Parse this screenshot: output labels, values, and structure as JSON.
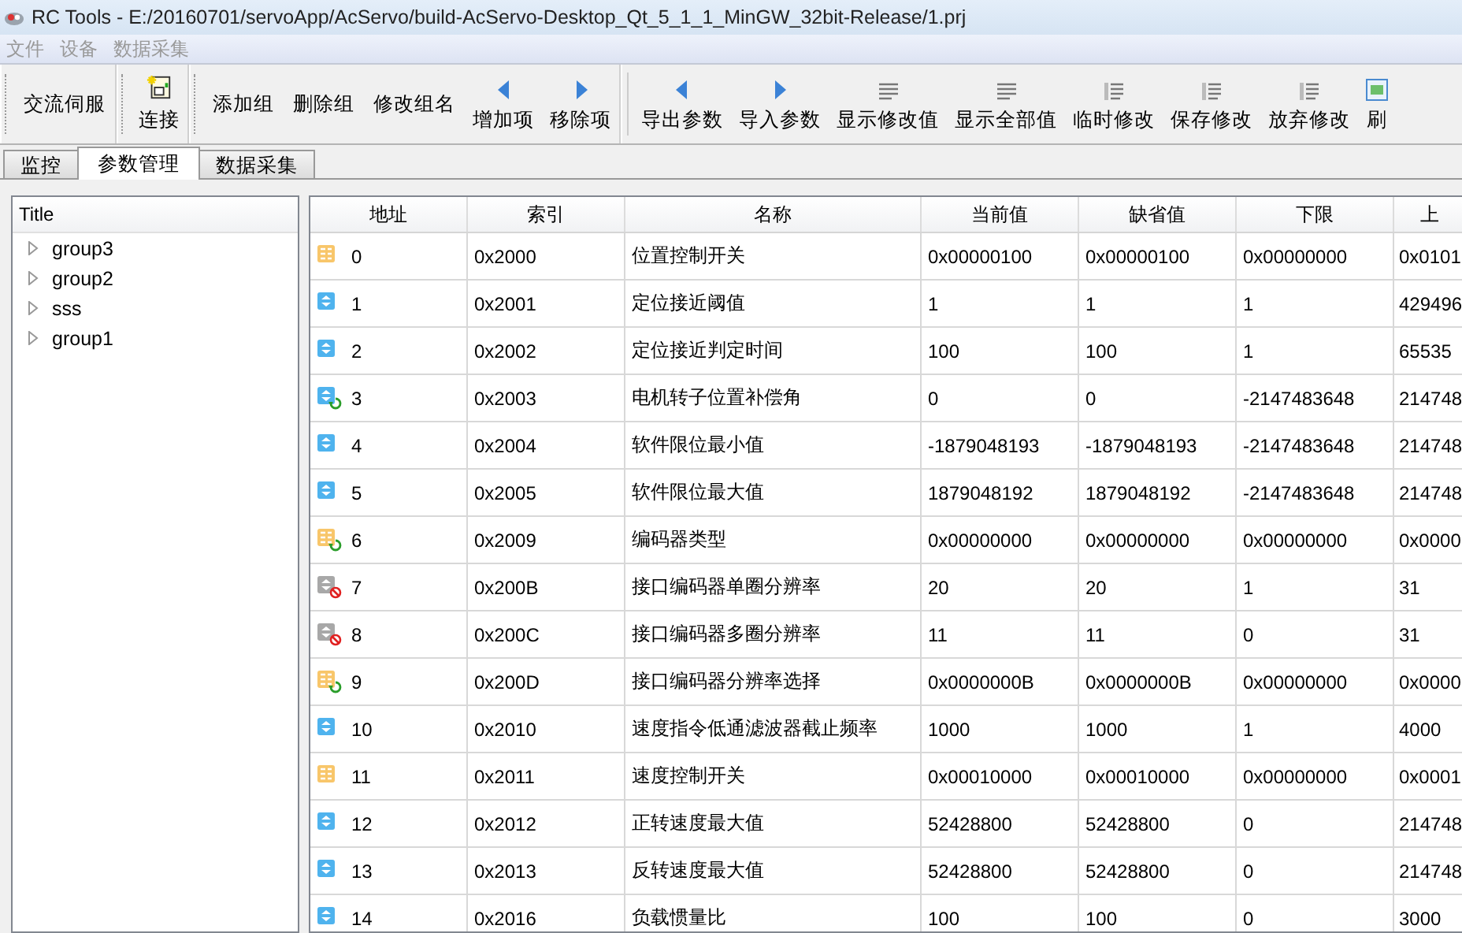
{
  "window": {
    "title": "RC Tools - E:/20160701/servoApp/AcServo/build-AcServo-Desktop_Qt_5_1_1_MinGW_32bit-Release/1.prj"
  },
  "menu": [
    "文件",
    "设备",
    "数据采集"
  ],
  "toolbars": [
    {
      "kind": "movable",
      "items": [
        {
          "label": "交流伺服",
          "kind": "text"
        }
      ]
    },
    {
      "kind": "movable",
      "items": [
        {
          "label": "连接",
          "kind": "connect"
        }
      ]
    },
    {
      "kind": "movable",
      "items": [
        {
          "label": "添加组",
          "kind": "text"
        },
        {
          "label": "删除组",
          "kind": "text"
        },
        {
          "label": "修改组名",
          "kind": "text"
        },
        {
          "label": "增加项",
          "kind": "left"
        },
        {
          "label": "移除项",
          "kind": "right"
        }
      ]
    },
    {
      "kind": "plain",
      "items": [
        {
          "label": "导出参数",
          "kind": "left"
        },
        {
          "label": "导入参数",
          "kind": "right"
        },
        {
          "label": "显示修改值",
          "kind": "lines"
        },
        {
          "label": "显示全部值",
          "kind": "lines"
        },
        {
          "label": "临时修改",
          "kind": "indent"
        },
        {
          "label": "保存修改",
          "kind": "indent"
        },
        {
          "label": "放弃修改",
          "kind": "indent"
        },
        {
          "label": "刷",
          "kind": "grid"
        }
      ]
    }
  ],
  "tabs": [
    {
      "label": "监控",
      "selected": false
    },
    {
      "label": "参数管理",
      "selected": true
    },
    {
      "label": "数据采集",
      "selected": false
    }
  ],
  "tree": {
    "header": "Title",
    "items": [
      {
        "label": "group3",
        "expanded": false
      },
      {
        "label": "group2",
        "expanded": false
      },
      {
        "label": "sss",
        "expanded": false
      },
      {
        "label": "group1",
        "expanded": false
      }
    ]
  },
  "table": {
    "columns": [
      "地址",
      "索引",
      "名称",
      "当前值",
      "缺省值",
      "下限",
      "上"
    ],
    "rows": [
      {
        "kind": "switch",
        "cells": [
          "0",
          "0x2000",
          "位置控制开关",
          "0x00000100",
          "0x00000100",
          "0x00000000",
          "0x0101"
        ]
      },
      {
        "kind": "number",
        "cells": [
          "1",
          "0x2001",
          "定位接近阈值",
          "1",
          "1",
          "1",
          "429496"
        ]
      },
      {
        "kind": "number",
        "cells": [
          "2",
          "0x2002",
          "定位接近判定时间",
          "100",
          "100",
          "1",
          "65535"
        ]
      },
      {
        "kind": "number-sync",
        "cells": [
          "3",
          "0x2003",
          "电机转子位置补偿角",
          "0",
          "0",
          "-2147483648",
          "214748"
        ]
      },
      {
        "kind": "number",
        "cells": [
          "4",
          "0x2004",
          "软件限位最小值",
          "-1879048193",
          "-1879048193",
          "-2147483648",
          "214748"
        ]
      },
      {
        "kind": "number",
        "cells": [
          "5",
          "0x2005",
          "软件限位最大值",
          "1879048192",
          "1879048192",
          "-2147483648",
          "214748"
        ]
      },
      {
        "kind": "switch-sync",
        "cells": [
          "6",
          "0x2009",
          "编码器类型",
          "0x00000000",
          "0x00000000",
          "0x00000000",
          "0x0000"
        ]
      },
      {
        "kind": "number-blocked",
        "cells": [
          "7",
          "0x200B",
          "接口编码器单圈分辨率",
          "20",
          "20",
          "1",
          "31"
        ]
      },
      {
        "kind": "number-blocked",
        "cells": [
          "8",
          "0x200C",
          "接口编码器多圈分辨率",
          "11",
          "11",
          "0",
          "31"
        ]
      },
      {
        "kind": "switch-sync",
        "cells": [
          "9",
          "0x200D",
          "接口编码器分辨率选择",
          "0x0000000B",
          "0x0000000B",
          "0x00000000",
          "0x0000"
        ]
      },
      {
        "kind": "number",
        "cells": [
          "10",
          "0x2010",
          "速度指令低通滤波器截止频率",
          "1000",
          "1000",
          "1",
          "4000"
        ]
      },
      {
        "kind": "switch",
        "cells": [
          "11",
          "0x2011",
          "速度控制开关",
          "0x00010000",
          "0x00010000",
          "0x00000000",
          "0x0001"
        ]
      },
      {
        "kind": "number",
        "cells": [
          "12",
          "0x2012",
          "正转速度最大值",
          "52428800",
          "52428800",
          "0",
          "214748"
        ]
      },
      {
        "kind": "number",
        "cells": [
          "13",
          "0x2013",
          "反转速度最大值",
          "52428800",
          "52428800",
          "0",
          "214748"
        ]
      },
      {
        "kind": "number",
        "cells": [
          "14",
          "0x2016",
          "负载惯量比",
          "100",
          "100",
          "0",
          "3000"
        ]
      }
    ]
  }
}
